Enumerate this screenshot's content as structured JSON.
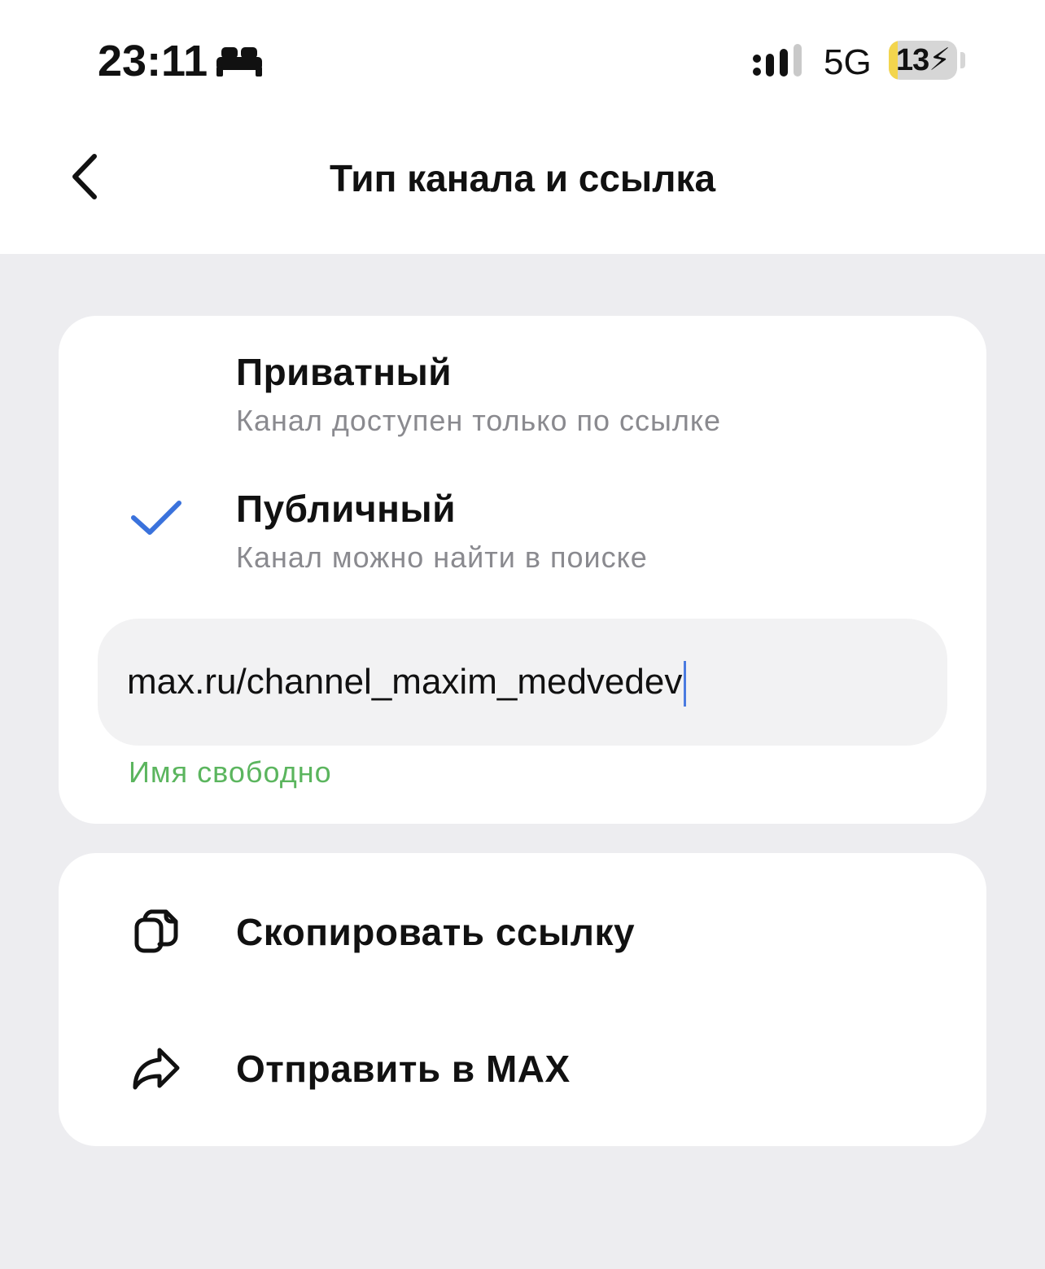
{
  "status_bar": {
    "time": "23:11",
    "network": "5G",
    "battery_percent": "13",
    "battery_level": 0.13,
    "charging": true
  },
  "header": {
    "title": "Тип канала и ссылка"
  },
  "channel_type": {
    "selected": "public",
    "options": [
      {
        "id": "private",
        "title": "Приватный",
        "description": "Канал доступен только по ссылке"
      },
      {
        "id": "public",
        "title": "Публичный",
        "description": "Канал можно найти в поиске"
      }
    ],
    "link_value": "max.ru/channel_maxim_medvedev",
    "availability": "Имя свободно"
  },
  "actions": [
    {
      "label": "Скопировать ссылку",
      "icon": "copy-icon"
    },
    {
      "label": "Отправить в MAX",
      "icon": "share-icon"
    }
  ],
  "colors": {
    "accent": "#3a72dc",
    "success": "#5bb55e",
    "background": "#ededf0",
    "secondary_text": "#8a8a8f"
  }
}
